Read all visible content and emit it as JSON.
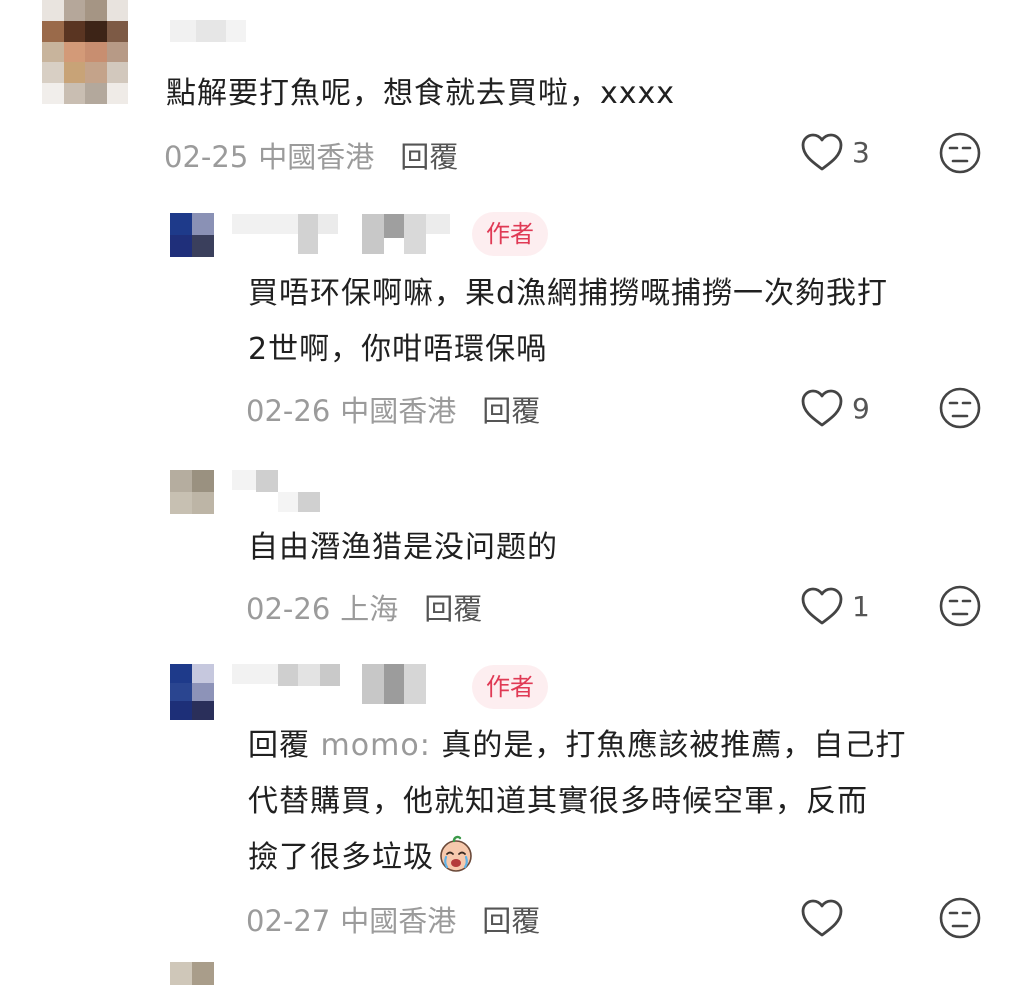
{
  "comments": [
    {
      "text": "點解要打魚呢，想食就去買啦，xxxx",
      "date": "02-25",
      "location": "中國香港",
      "reply_label": "回覆",
      "likes": "3"
    },
    {
      "author_tag": "作者",
      "text_line1": "買唔环保啊嘛，果d漁網捕撈嘅捕撈一次夠我打",
      "text_line2": "2世啊，你咁唔環保喎",
      "date": "02-26",
      "location": "中國香港",
      "reply_label": "回覆",
      "likes": "9"
    },
    {
      "text": "自由潛渔猎是没问题的",
      "date": "02-26",
      "location": "上海",
      "reply_label": "回覆",
      "likes": "1"
    },
    {
      "author_tag": "作者",
      "reply_prefix": "回覆",
      "mention": "momo:",
      "text_line1_rest": "真的是，打魚應該被推薦，自己打",
      "text_line2": "代替購買，他就知道其實很多時候空軍，反而",
      "text_line3": "撿了很多垃圾",
      "date": "02-27",
      "location": "中國香港",
      "reply_label": "回覆",
      "likes": ""
    }
  ],
  "colors": {
    "author_tag_bg": "#fdeef0",
    "author_tag_text": "#e03a55",
    "meta_text": "#9b9b9b"
  },
  "icons": [
    "heart-outline-icon",
    "dislike-face-icon",
    "crying-face-emoji"
  ]
}
